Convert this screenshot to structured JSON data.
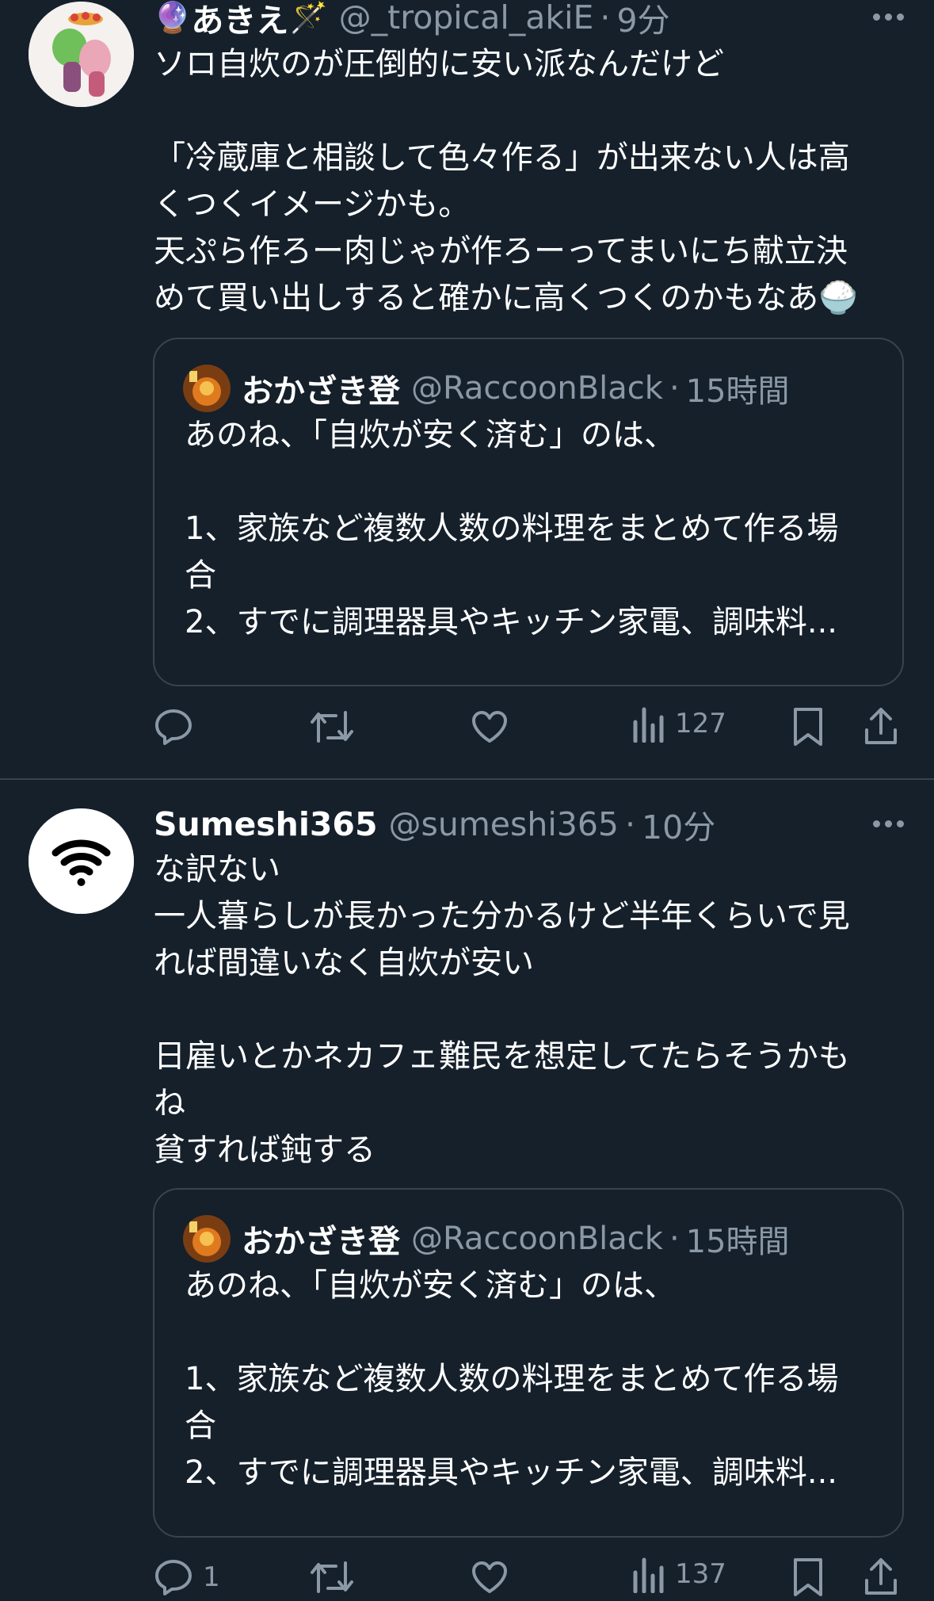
{
  "tweets": [
    {
      "name": "あきえ",
      "name_prefix_emoji": "🔮",
      "name_suffix_emoji": "🪄",
      "handle": "@_tropical_akiE",
      "time": "9分",
      "body_lines": [
        "ソロ自炊のが圧倒的に安い派なんだけど",
        "",
        "「冷蔵庫と相談して色々作る」が出来ない人は高",
        "くつくイメージかも。",
        "天ぷら作ろー肉じゃが作ろーってまいにち献立決",
        "めて買い出しすると確かに高くつくのかもなあ🍚"
      ],
      "quote": {
        "name": "おかざき登",
        "handle": "@RaccoonBlack",
        "time": "15時間",
        "body_lines": [
          "あのね、「自炊が安く済む」のは、",
          "",
          "1、家族など複数人数の料理をまとめて作る場",
          "合",
          "2、すでに調理器具やキッチン家電、調味料..."
        ]
      },
      "actions": {
        "replies": "",
        "retweets": "",
        "likes": "",
        "views": "127"
      }
    },
    {
      "name": "Sumeshi365",
      "handle": "@sumeshi365",
      "time": "10分",
      "body_lines": [
        "な訳ない",
        "一人暮らしが長かった分かるけど半年くらいで見",
        "れば間違いなく自炊が安い",
        "",
        "日雇いとかネカフェ難民を想定してたらそうかも",
        "ね",
        "貧すれば鈍する"
      ],
      "quote": {
        "name": "おかざき登",
        "handle": "@RaccoonBlack",
        "time": "15時間",
        "body_lines": [
          "あのね、「自炊が安く済む」のは、",
          "",
          "1、家族など複数人数の料理をまとめて作る場",
          "合",
          "2、すでに調理器具やキッチン家電、調味料..."
        ]
      },
      "actions": {
        "replies": "1",
        "retweets": "",
        "likes": "",
        "views": "137"
      }
    }
  ],
  "icons": {
    "reply": "reply-icon",
    "retweet": "retweet-icon",
    "like": "like-icon",
    "views": "views-icon",
    "bookmark": "bookmark-icon",
    "share": "share-icon",
    "more": "more-icon"
  },
  "colors": {
    "background": "#15202b",
    "secondary_text": "#8b98a5",
    "border": "#38444d"
  }
}
